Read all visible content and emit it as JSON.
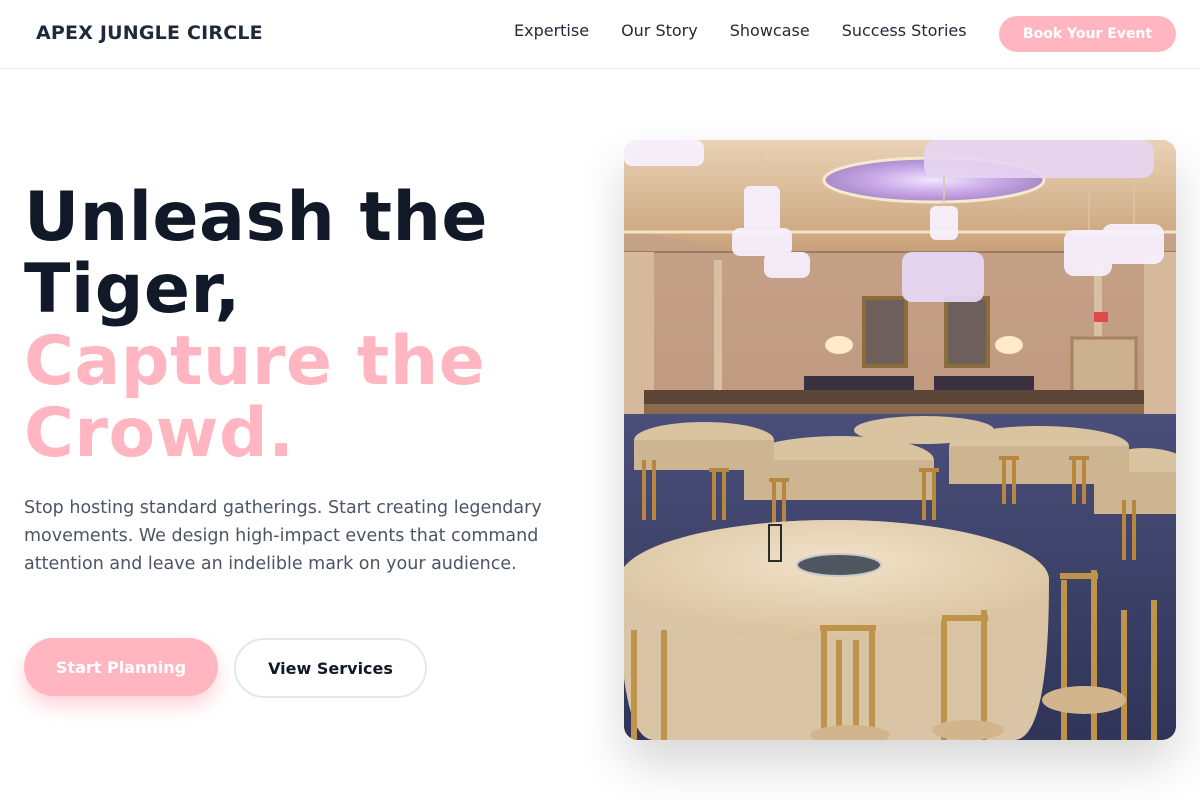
{
  "header": {
    "brand": "APEX JUNGLE CIRCLE",
    "nav": [
      {
        "label": "Expertise"
      },
      {
        "label": "Our Story"
      },
      {
        "label": "Showcase"
      },
      {
        "label": "Success Stories"
      }
    ],
    "cta_label": "Book Your Event"
  },
  "hero": {
    "heading_lines": [
      "Unleash the",
      "Tiger,",
      "Capture the",
      "Crowd."
    ],
    "description": "Stop hosting standard gatherings. Start creating legendary movements. We design high-impact events that command attention and leave an indelible mark on your audience.",
    "primary_button": "Start Planning",
    "secondary_button": "View Services",
    "image_icon": "banquet-hall-photo"
  },
  "colors": {
    "accent": "#ffb6c1",
    "heading": "#111827",
    "body_text": "#4b5563"
  }
}
